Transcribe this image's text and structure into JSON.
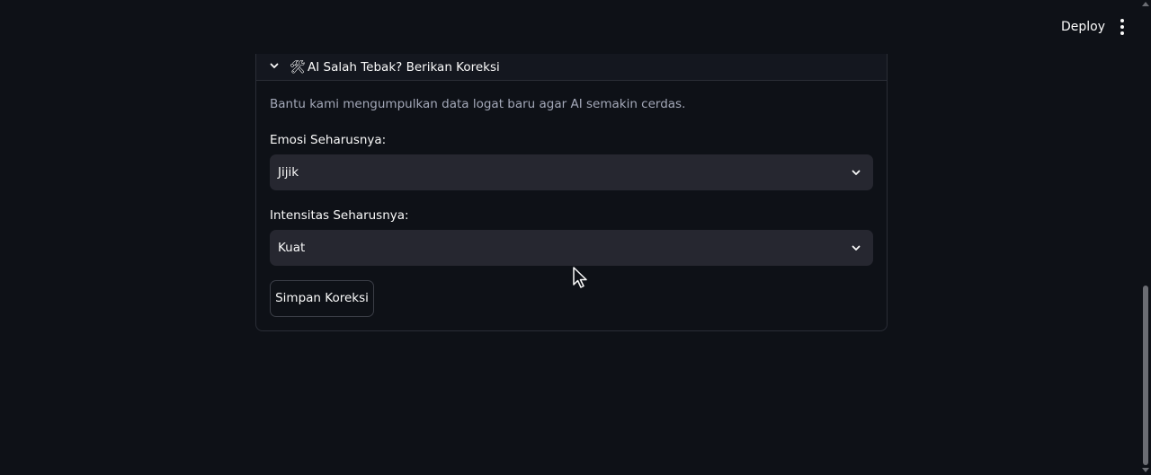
{
  "header": {
    "deploy_label": "Deploy",
    "menu_icon": "vertical-dots-icon"
  },
  "expander": {
    "icon": "🛠",
    "title": "AI Salah Tebak? Berikan Koreksi",
    "expanded": true,
    "description": "Bantu kami mengumpulkan data logat baru agar AI semakin cerdas.",
    "emotion": {
      "label": "Emosi Seharusnya:",
      "selected": "Jijik"
    },
    "intensity": {
      "label": "Intensitas Seharusnya:",
      "selected": "Kuat"
    },
    "save_label": "Simpan Koreksi"
  },
  "colors": {
    "background": "#0e1117",
    "select_bg": "#262730",
    "text": "#fafafa",
    "muted_text": "#a3a8b8"
  }
}
